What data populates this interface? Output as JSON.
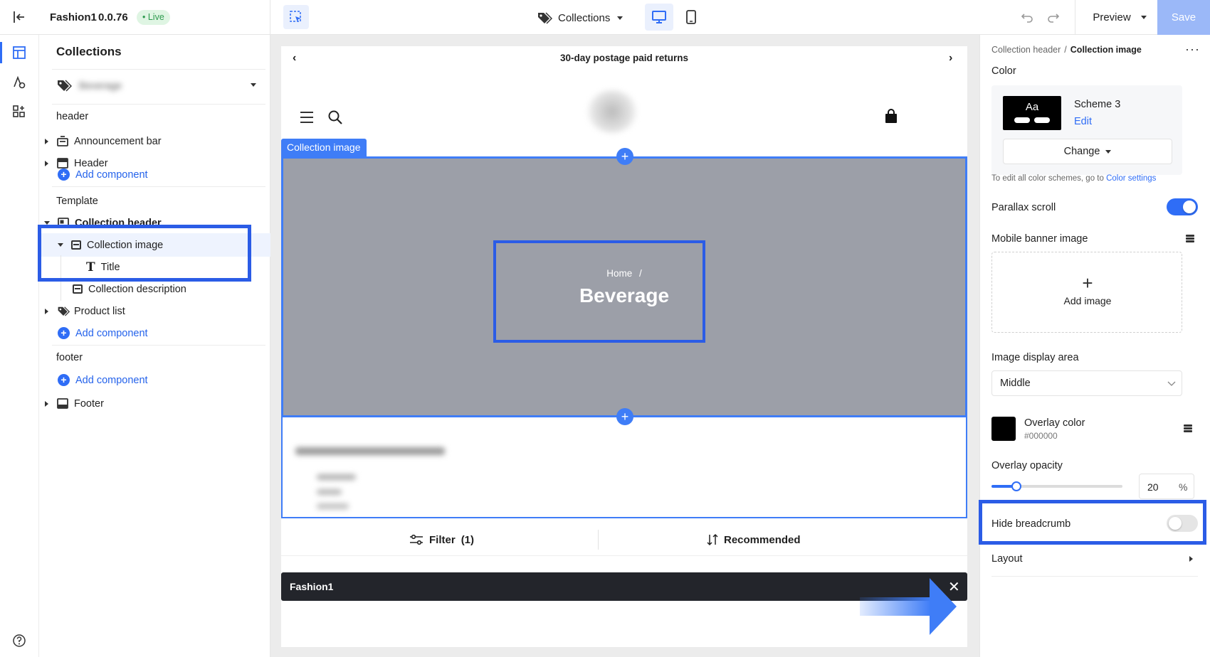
{
  "topbar": {
    "app_name": "Fashion1",
    "version": "0.0.76",
    "live_badge": "• Live",
    "page_selector": "Collections",
    "preview_label": "Preview",
    "save_label": "Save"
  },
  "sidebar": {
    "title": "Collections",
    "selector_value": "Beverage",
    "sections": {
      "header": "header",
      "template": "Template",
      "footer": "footer"
    },
    "items": {
      "announcement_bar": "Announcement bar",
      "header": "Header",
      "collection_header": "Collection header",
      "collection_image": "Collection image",
      "title": "Title",
      "collection_description": "Collection description",
      "product_list": "Product list",
      "footer": "Footer"
    },
    "add_component": "Add component"
  },
  "canvas": {
    "announcement": "30-day postage paid returns",
    "selected_tag": "Collection image",
    "breadcrumb_home": "Home",
    "breadcrumb_sep": "/",
    "collection_title": "Beverage",
    "filter_label": "Filter",
    "filter_count": "(1)",
    "sort_label": "Recommended",
    "bottom_bar_title": "Fashion1"
  },
  "right_panel": {
    "breadcrumb_parent": "Collection header",
    "breadcrumb_sep": "/",
    "breadcrumb_current": "Collection image",
    "color_label": "Color",
    "scheme_preview_text": "Aa",
    "scheme_name": "Scheme 3",
    "scheme_edit": "Edit",
    "change_button": "Change",
    "color_hint": "To edit all color schemes, go to",
    "color_settings_link": "Color settings",
    "parallax_label": "Parallax scroll",
    "parallax_on": true,
    "mobile_banner_label": "Mobile banner image",
    "add_image_label": "Add image",
    "display_area_label": "Image display area",
    "display_area_value": "Middle",
    "overlay_color_label": "Overlay color",
    "overlay_color_value": "#000000",
    "overlay_opacity_label": "Overlay opacity",
    "overlay_opacity_value": "20",
    "overlay_opacity_unit": "%",
    "hide_breadcrumb_label": "Hide breadcrumb",
    "hide_breadcrumb_on": false,
    "layout_label": "Layout"
  },
  "colors": {
    "accent": "#2f6df6",
    "highlight_frame": "#2b5ce6",
    "banner_gray": "#9c9fa8",
    "save_bg": "#9bb8f8",
    "live_badge_bg": "#dff5e3",
    "live_badge_text": "#2e9b4f"
  }
}
